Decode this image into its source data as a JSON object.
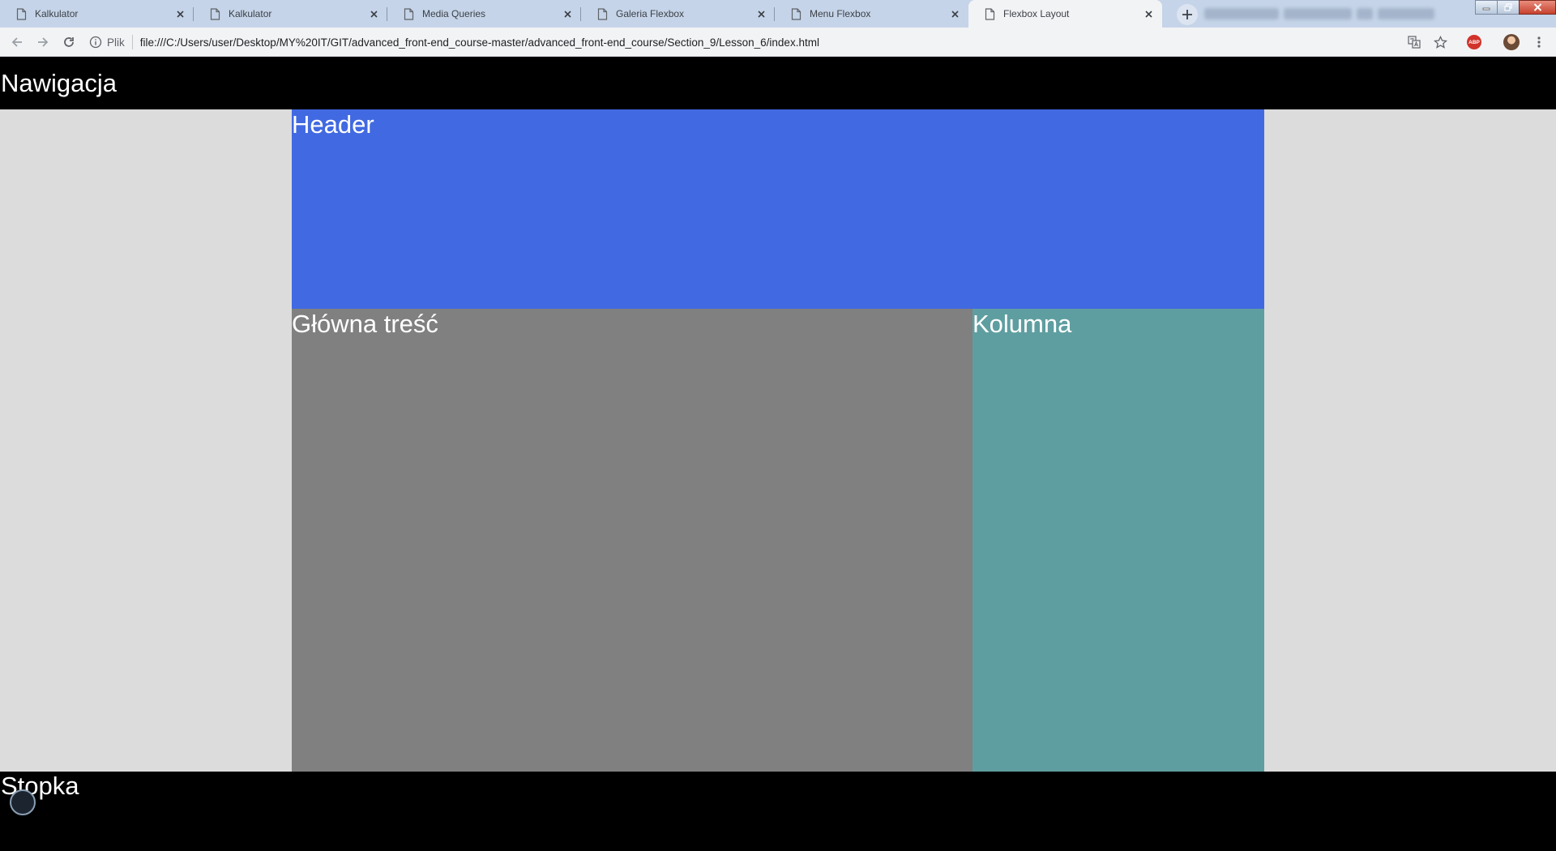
{
  "browser": {
    "tabs": [
      {
        "title": "Kalkulator"
      },
      {
        "title": "Kalkulator"
      },
      {
        "title": "Media Queries"
      },
      {
        "title": "Galeria Flexbox"
      },
      {
        "title": "Menu Flexbox"
      },
      {
        "title": "Flexbox Layout"
      }
    ],
    "active_tab_index": 5,
    "address": {
      "scheme_label": "Plik",
      "url": "file:///C:/Users/user/Desktop/MY%20IT/GIT/advanced_front-end_course-master/advanced_front-end_course/Section_9/Lesson_6/index.html"
    },
    "extensions": {
      "adblock_label": "ABP"
    }
  },
  "page": {
    "nav_text": "Nawigacja",
    "header_text": "Header",
    "main_text": "Główna treść",
    "aside_text": "Kolumna",
    "footer_text": "Stopka"
  },
  "colors": {
    "nav_bg": "#000000",
    "page_bg": "#dcdcdc",
    "header_bg": "#4169e1",
    "main_bg": "#808080",
    "aside_bg": "#5f9ea0",
    "footer_bg": "#000000",
    "text": "#ffffff"
  },
  "icons": [
    "doc-icon",
    "close-icon",
    "plus-icon",
    "back-arrow-icon",
    "forward-arrow-icon",
    "reload-icon",
    "info-icon",
    "translate-icon",
    "star-icon",
    "adblock-icon",
    "profile-avatar",
    "menu-dots-icon",
    "minimize-icon",
    "restore-icon",
    "window-close-icon"
  ]
}
